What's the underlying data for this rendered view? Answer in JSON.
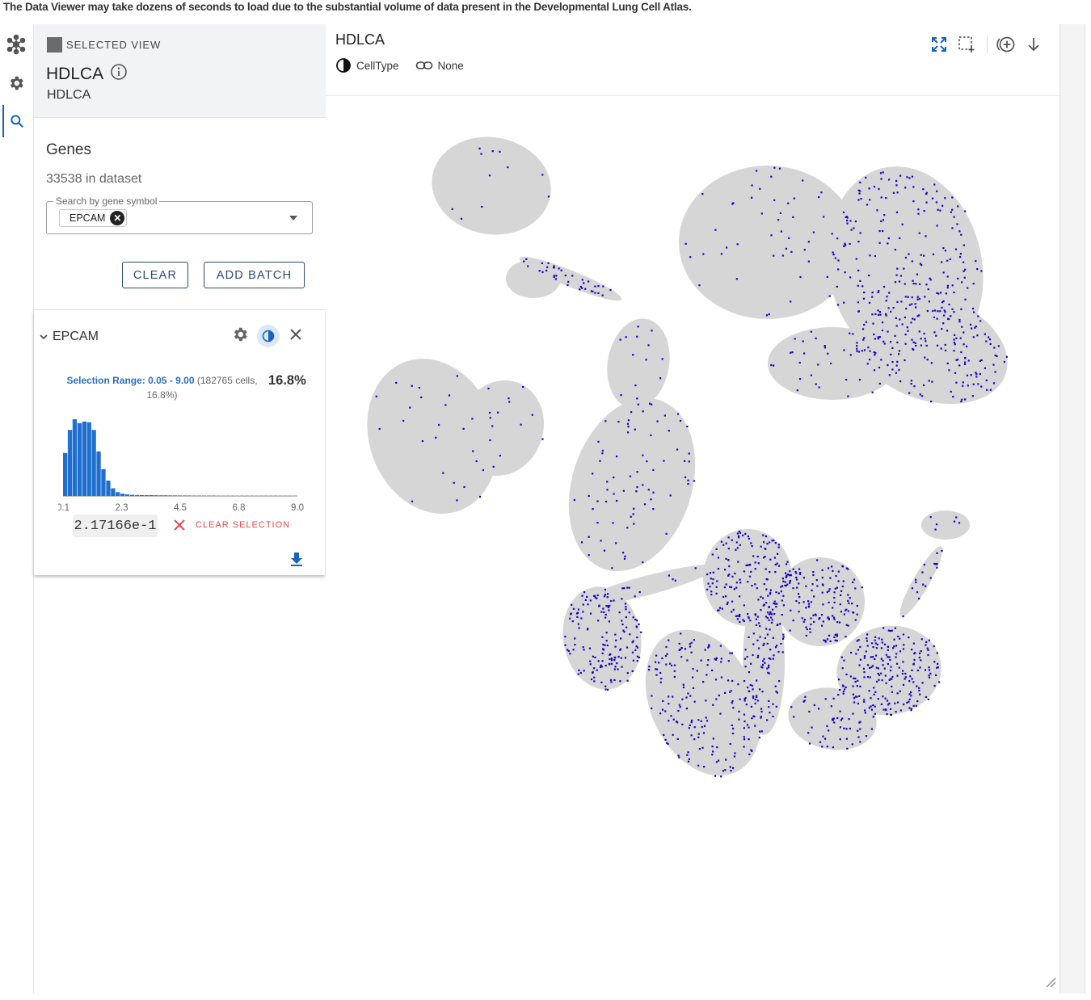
{
  "banner": "The Data Viewer may take dozens of seconds to load due to the substantial volume of data present in the Developmental Lung Cell Atlas.",
  "rail": {
    "items": [
      {
        "name": "network",
        "icon": "network-icon"
      },
      {
        "name": "settings",
        "icon": "gear-icon"
      },
      {
        "name": "search",
        "icon": "search-icon",
        "active": true
      }
    ]
  },
  "selected_view": {
    "label": "SELECTED VIEW",
    "title": "HDLCA",
    "subtitle": "HDLCA",
    "swatch_color": "#6b6b6b"
  },
  "genes": {
    "title": "Genes",
    "count_text": "33538 in dataset",
    "search_legend": "Search by gene symbol",
    "chip": "EPCAM",
    "clear_label": "CLEAR",
    "add_batch_label": "ADD BATCH"
  },
  "gene_card": {
    "gene": "EPCAM",
    "range_label": "Selection Range: 0.05 - 9.00",
    "range_detail": "(182765 cells, 16.8%)",
    "percent": "16.8%",
    "hist_ticks": [
      "0.1",
      "2.3",
      "4.5",
      "6.8",
      "9.0"
    ],
    "hist_color": "#1f6fd1",
    "value_display": "2.17166e-1",
    "clear_selection_label": "CLEAR SELECTION"
  },
  "main": {
    "title": "HDLCA",
    "color_by": "CellType",
    "link": "None"
  },
  "colors": {
    "accent": "#1565c0",
    "cell_gray": "#d6d6d6",
    "expr_blue": "#1a00c8",
    "danger": "#e54b4b"
  }
}
